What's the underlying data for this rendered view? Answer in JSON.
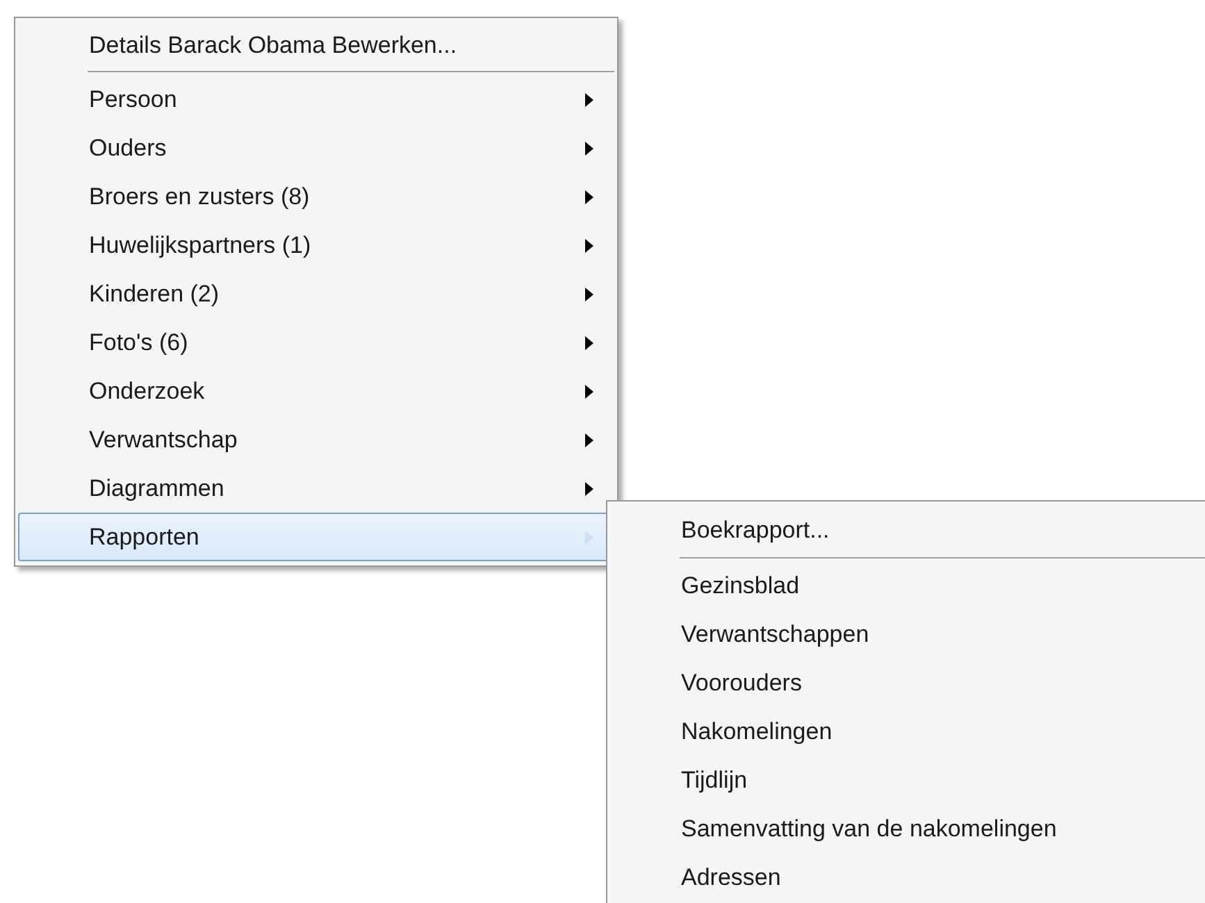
{
  "context_menu": {
    "header_item": "Details Barack Obama Bewerken...",
    "items": [
      {
        "label": "Persoon",
        "has_submenu": true,
        "selected": false
      },
      {
        "label": "Ouders",
        "has_submenu": true,
        "selected": false
      },
      {
        "label": "Broers en zusters (8)",
        "has_submenu": true,
        "selected": false
      },
      {
        "label": "Huwelijkspartners (1)",
        "has_submenu": true,
        "selected": false
      },
      {
        "label": "Kinderen (2)",
        "has_submenu": true,
        "selected": false
      },
      {
        "label": "Foto's (6)",
        "has_submenu": true,
        "selected": false
      },
      {
        "label": "Onderzoek",
        "has_submenu": true,
        "selected": false
      },
      {
        "label": "Verwantschap",
        "has_submenu": true,
        "selected": false
      },
      {
        "label": "Diagrammen",
        "has_submenu": true,
        "selected": false
      },
      {
        "label": "Rapporten",
        "has_submenu": true,
        "selected": true
      }
    ]
  },
  "submenu": {
    "header_item": "Boekrapport...",
    "items": [
      {
        "label": "Gezinsblad",
        "selected": false
      },
      {
        "label": "Verwantschappen",
        "selected": false
      },
      {
        "label": "Voorouders",
        "selected": false
      },
      {
        "label": "Nakomelingen",
        "selected": false
      },
      {
        "label": "Tijdlijn",
        "selected": false
      },
      {
        "label": "Samenvatting van de nakomelingen",
        "selected": false
      },
      {
        "label": "Adressen",
        "selected": false
      }
    ]
  }
}
